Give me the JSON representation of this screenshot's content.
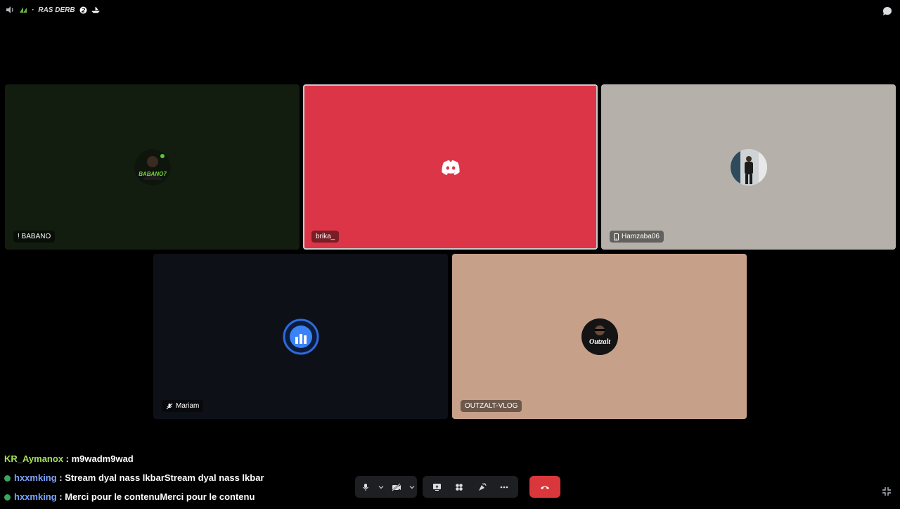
{
  "topbar": {
    "channel_name": "RAS DERB",
    "icons": [
      "volume-icon",
      "leaf-icon",
      "dot-separator",
      "badge-icon",
      "boat-icon",
      "chat-bubble-icon"
    ]
  },
  "tiles": [
    {
      "name": "! BABANO",
      "bg": "#121d10",
      "avatar": "BABANO7",
      "has_icon": false
    },
    {
      "name": "brika_",
      "bg": "#dc3547",
      "avatar": "discord-logo",
      "speaking": true
    },
    {
      "name": "Hamzaba06",
      "bg": "#b5b1aa",
      "avatar": "person-photo",
      "icon": "mobile-icon"
    },
    {
      "name": "Mariam",
      "bg": "#0d1117",
      "avatar": "stats-logo",
      "icon": "mic-muted-icon"
    },
    {
      "name": "OUTZALT-VLOG",
      "bg": "#c7a08a",
      "avatar": "Outzalt"
    }
  ],
  "chat": [
    {
      "user": "KR_Aymanox",
      "color": "green",
      "message": "m9wadm9wad",
      "badge": false
    },
    {
      "user": "hxxmking",
      "color": "blue",
      "message": "Stream dyal nass lkbarStream dyal nass lkbar",
      "badge": true
    },
    {
      "user": "hxxmking",
      "color": "blue",
      "message": "Merci pour le contenuMerci pour le contenu",
      "badge": true
    }
  ],
  "chat_separator": " : ",
  "controls": {
    "buttons": [
      "mic-icon",
      "mic-options-chevron",
      "camera-off-icon",
      "camera-options-chevron",
      "screen-share-icon",
      "activities-icon",
      "soundboard-icon",
      "more-icon",
      "hang-up-icon"
    ],
    "hangup_color": "#da373c"
  }
}
